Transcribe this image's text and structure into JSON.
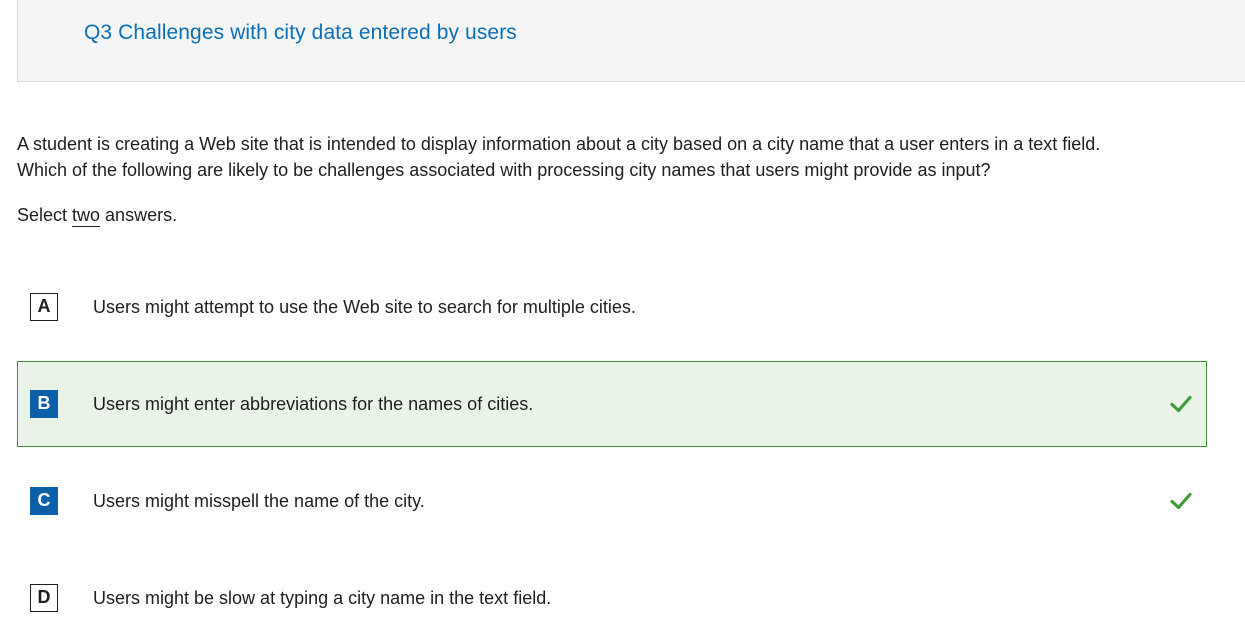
{
  "question": {
    "title": "Q3 Challenges with city data entered by users",
    "prompt_line1": "A student is creating a Web site that is intended to display information about a city based on a city name that a user enters in a text field.",
    "prompt_line2": "Which of the following are likely to be challenges associated with processing city names that users might provide as input?",
    "instruction_prefix": "Select ",
    "instruction_emph": "two",
    "instruction_suffix": " answers."
  },
  "options": [
    {
      "letter": "A",
      "text": "Users might attempt to use the Web site to search for multiple cities.",
      "selected": false,
      "correct": false
    },
    {
      "letter": "B",
      "text": "Users might enter abbreviations for the names of cities.",
      "selected": true,
      "correct": true
    },
    {
      "letter": "C",
      "text": "Users might misspell the name of the city.",
      "selected": false,
      "correct": true
    },
    {
      "letter": "D",
      "text": "Users might be slow at typing a city name in the text field.",
      "selected": false,
      "correct": false
    }
  ],
  "colors": {
    "title": "#0b6fb8",
    "letter_fill": "#0b5ea8",
    "selected_bg": "#e9f3e8",
    "selected_border": "#3f8f3a",
    "check": "#3f9a3a"
  },
  "icons": {
    "correct": "check-icon"
  }
}
